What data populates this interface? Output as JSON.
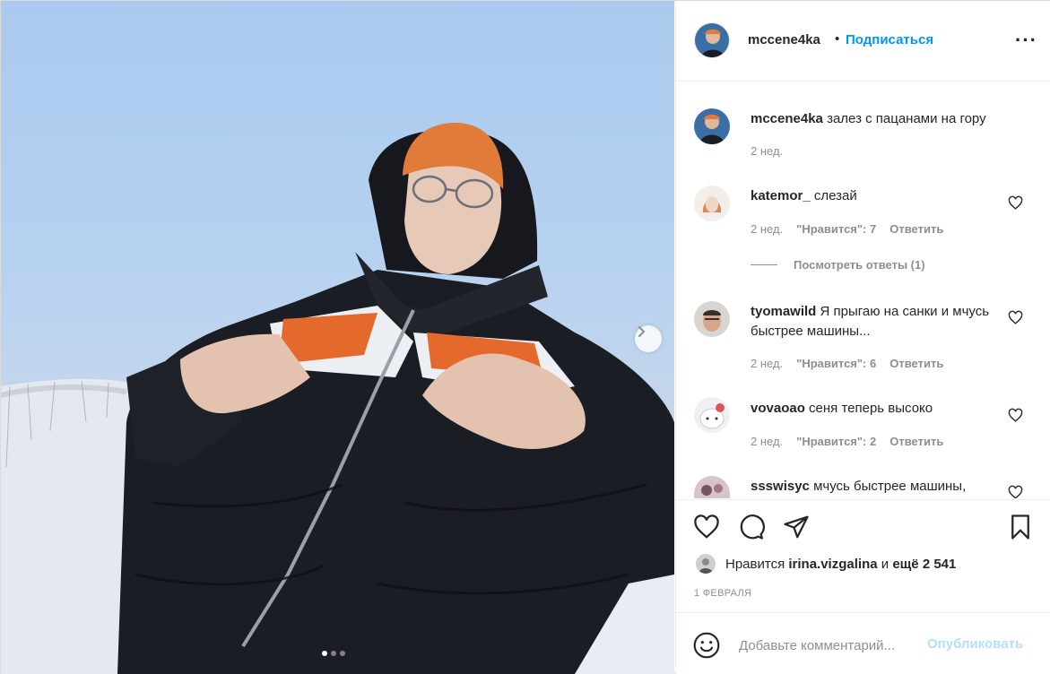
{
  "post": {
    "username": "mccene4ka",
    "separator": "•",
    "follow_label": "Подписаться",
    "more_icon": "more-horizontal-icon",
    "caption_text": "залез с пацанами на гору",
    "caption_time": "2 нед.",
    "carousel": {
      "total": 3,
      "active": 1
    }
  },
  "comments": [
    {
      "user": "katemor_",
      "text": "слезай",
      "time": "2 нед.",
      "likes": "\"Нравится\": 7",
      "reply": "Ответить"
    },
    {
      "user": "tyomawild",
      "text": "Я прыгаю на санки и мчусь быстрее машины...",
      "time": "2 нед.",
      "likes": "\"Нравится\": 6",
      "reply": "Ответить"
    },
    {
      "user": "vovaoao",
      "text": "сеня теперь высоко",
      "time": "2 нед.",
      "likes": "\"Нравится\": 2",
      "reply": "Ответить"
    },
    {
      "user": "ssswisyc",
      "text": "мчусь быстрее машины,"
    }
  ],
  "view_replies": "Посмотреть ответы (1)",
  "likes": {
    "prefix": "Нравится",
    "user": "irina.vizgalina",
    "middle": "и",
    "rest": "ещё 2 541"
  },
  "date": "1 ФЕВРАЛЯ",
  "add_comment": {
    "placeholder": "Добавьте комментарий...",
    "publish_label": "Опубликовать"
  },
  "colors": {
    "accent": "#0095f6",
    "publish_disabled": "#b2dffc",
    "meta": "#8e8e8e"
  }
}
